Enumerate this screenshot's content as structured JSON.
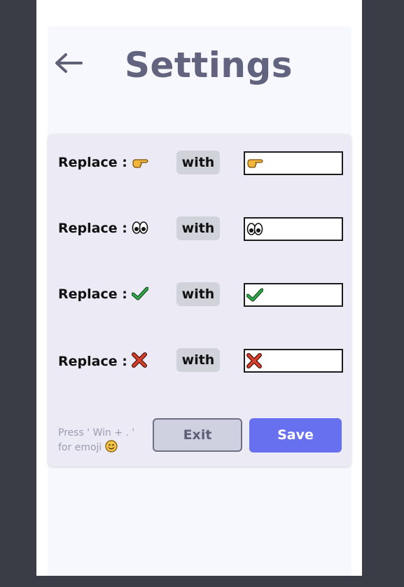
{
  "header": {
    "title": "Settings",
    "back_icon": "arrow-left-icon"
  },
  "replacements": [
    {
      "label": "Replace :",
      "emoji_icon": "pointing-hand-icon",
      "with_label": "with",
      "input_icon": "pointing-hand-icon"
    },
    {
      "label": "Replace :",
      "emoji_icon": "eyes-icon",
      "with_label": "with",
      "input_icon": "eyes-icon"
    },
    {
      "label": "Replace :",
      "emoji_icon": "check-mark-icon",
      "with_label": "with",
      "input_icon": "check-mark-icon"
    },
    {
      "label": "Replace :",
      "emoji_icon": "cross-mark-icon",
      "with_label": "with",
      "input_icon": "cross-mark-icon"
    }
  ],
  "footer": {
    "hint": "Press ' Win + . ' for emoji",
    "hint_icon": "smiling-face-icon",
    "exit_label": "Exit",
    "save_label": "Save"
  },
  "colors": {
    "accent": "#6770ef",
    "title": "#62637e",
    "card": "#ebeaf5",
    "check": "#2fa94a",
    "cross": "#d9412c",
    "hand": "#f2b53c"
  }
}
